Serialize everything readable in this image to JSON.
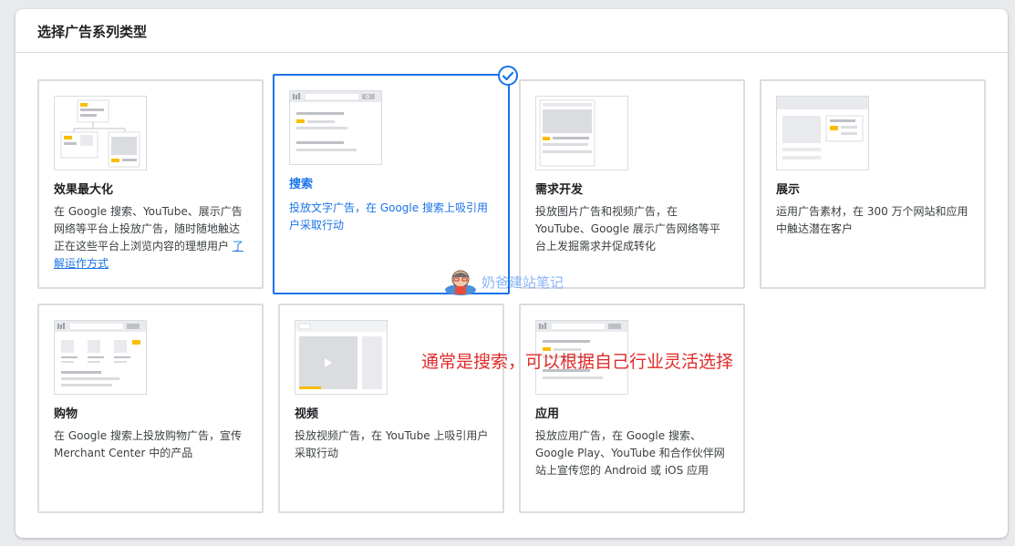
{
  "panel": {
    "title": "选择广告系列类型"
  },
  "cards": [
    {
      "title": "效果最大化",
      "desc": "在 Google 搜索、YouTube、展示广告网络等平台上投放广告，随时随地触达正在这些平台上浏览内容的理想用户",
      "link": "了解运作方式",
      "selected": false
    },
    {
      "title": "搜索",
      "desc": "投放文字广告，在 Google 搜索上吸引用户采取行动",
      "selected": true
    },
    {
      "title": "需求开发",
      "desc": "投放图片广告和视频广告，在 YouTube、Google 展示广告网络等平台上发掘需求并促成转化",
      "selected": false
    },
    {
      "title": "展示",
      "desc": "运用广告素材，在 300 万个网站和应用中触达潜在客户",
      "selected": false
    },
    {
      "title": "购物",
      "desc": "在 Google 搜索上投放购物广告，宣传 Merchant Center 中的产品",
      "selected": false
    },
    {
      "title": "视频",
      "desc": "投放视频广告，在 YouTube 上吸引用户采取行动",
      "selected": false
    },
    {
      "title": "应用",
      "desc": "投放应用广告，在 Google 搜索、Google Play、YouTube 和合作伙伴网站上宣传您的 Android 或 iOS 应用",
      "selected": false
    }
  ],
  "annotation": "通常是搜索，可以根据自己行业灵活选择",
  "watermark": "奶爸建站笔记",
  "colors": {
    "accent": "#1a73e8",
    "yellow": "#fbbc04",
    "border": "#dadce0",
    "annotation": "#e22a2a"
  }
}
